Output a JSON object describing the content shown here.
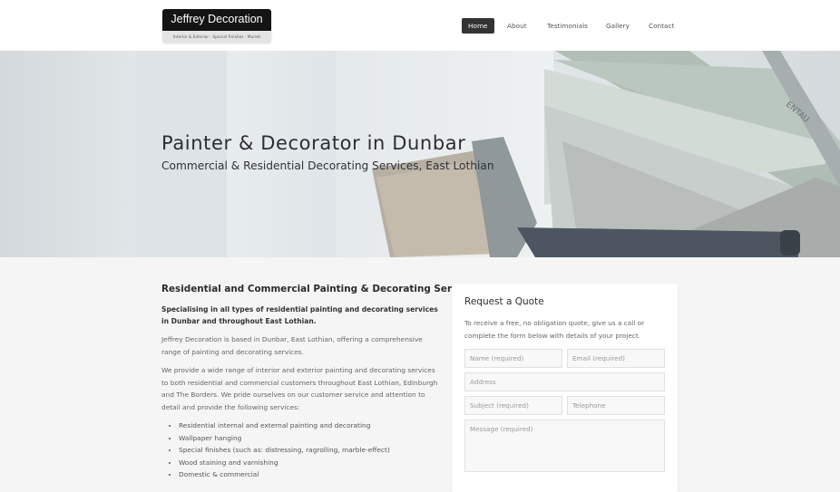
{
  "header": {
    "logo": {
      "name": "Jeffrey Decoration",
      "tagline": "Interior & Exterior · Special finishes · Murals"
    },
    "nav": [
      {
        "label": "Home",
        "active": true
      },
      {
        "label": "About",
        "active": false
      },
      {
        "label": "Testimonials",
        "active": false
      },
      {
        "label": "Gallery",
        "active": false
      },
      {
        "label": "Contact",
        "active": false
      }
    ]
  },
  "hero": {
    "title": "Painter & Decorator in Dunbar",
    "subtitle": "Commercial & Residential Decorating Services, East Lothian",
    "image_text": "ENTAU"
  },
  "content": {
    "heading": "Residential and Commercial Painting & Decorating Services",
    "lead": "Specialising in all types of residential painting and decorating services in Dunbar and throughout East Lothian.",
    "paragraphs": [
      "Jeffrey Decoration is based in Dunbar, East Lothian, offering a comprehensive range of painting and decorating services.",
      "We provide a wide range of interior and exterior painting and decorating services to both residential and commercial customers throughout East Lothian, Edinburgh and The Borders. We pride ourselves on our customer service and attention to detail and provide the following services:"
    ],
    "services": [
      "Residential internal and external painting and decorating",
      "Wallpaper hanging",
      "Special finishes (such as: distressing, ragrolling, marble-effect)",
      "Wood staining and varnishing",
      "Domestic & commercial"
    ]
  },
  "quote_form": {
    "title": "Request a Quote",
    "description": "To receive a free, no obligation quote, give us a call or complete the form below with details of your project.",
    "fields": {
      "name": "Name (required)",
      "email": "Email (required)",
      "address": "Address",
      "subject": "Subject (required)",
      "telephone": "Telephone",
      "message": "Message (required)"
    }
  },
  "colors": {
    "nav_active_bg": "#333333",
    "logo_bg": "#141414",
    "page_bg": "#f5f5f5"
  }
}
